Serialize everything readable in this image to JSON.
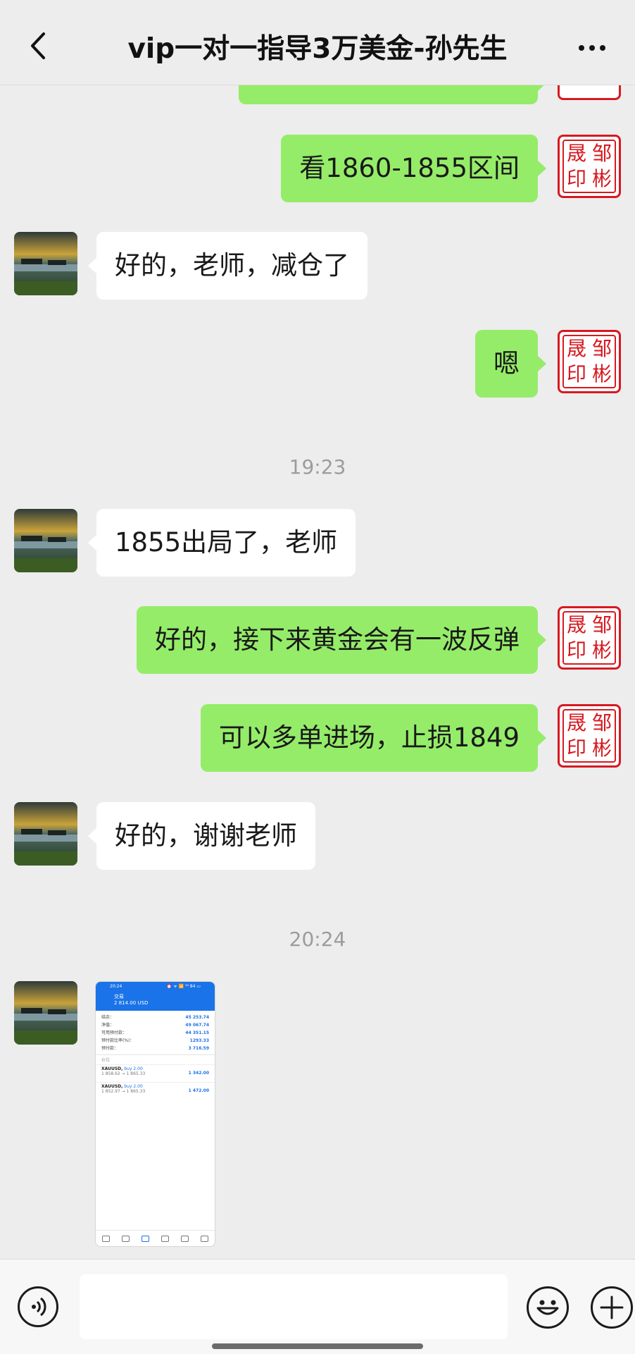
{
  "header": {
    "title": "vip一对一指导3万美金-孙先生"
  },
  "seal_chars": [
    "邹",
    "晟",
    "彬",
    "印"
  ],
  "messages": [
    {
      "side": "me",
      "text": "看1860-1855区间"
    },
    {
      "side": "them",
      "text": "好的，老师，减仓了"
    },
    {
      "side": "me",
      "text": "嗯"
    },
    {
      "time": "19:23"
    },
    {
      "side": "them",
      "text": "1855出局了，老师"
    },
    {
      "side": "me",
      "text": "好的，接下来黄金会有一波反弹"
    },
    {
      "side": "me",
      "text": "可以多单进场，止损1849"
    },
    {
      "side": "them",
      "text": "好的，谢谢老师"
    },
    {
      "time": "20:24"
    }
  ],
  "shared_screenshot": {
    "status_time": "20:24",
    "status_right": "⏰ ᯤ 📶 ⁹⁴ 84 ▭",
    "tab_title": "交易",
    "balance_line": "2 814.00 USD",
    "rows": [
      {
        "label": "结余：",
        "value": "45 253.74"
      },
      {
        "label": "净值：",
        "value": "49 067.74"
      },
      {
        "label": "可用预付款：",
        "value": "44 351.15"
      },
      {
        "label": "预付款比率(%)：",
        "value": "1293.33"
      },
      {
        "label": "预付款：",
        "value": "3 716.59"
      }
    ],
    "section": "价位",
    "positions": [
      {
        "symbol": "XAUUSD,",
        "side": " buy 2.00",
        "prices": "1 858.62 → 1 865.33",
        "profit": "1 342.00"
      },
      {
        "symbol": "XAUUSD,",
        "side": " buy 2.00",
        "prices": "1 852.97 → 1 865.33",
        "profit": "1 472.00"
      }
    ]
  },
  "colors": {
    "me_bubble": "#95ec69",
    "them_bubble": "#ffffff",
    "seal": "#d71920",
    "background": "#ededed"
  }
}
